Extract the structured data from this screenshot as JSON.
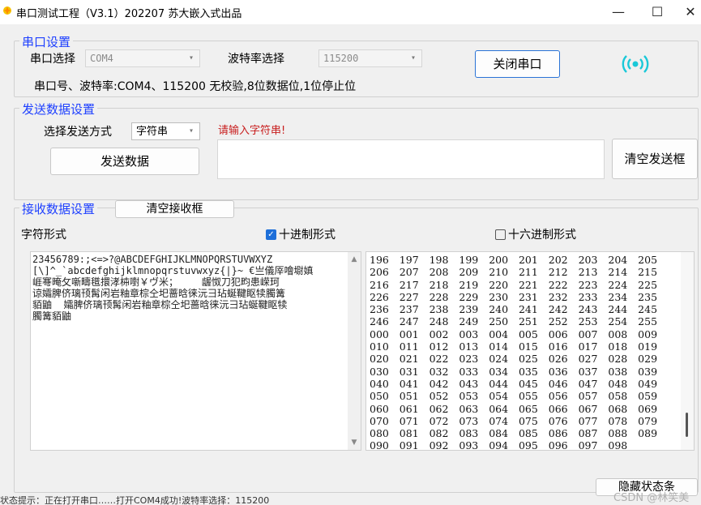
{
  "window": {
    "title": "串口测试工程（V3.1）202207    苏大嵌入式出品",
    "minimize": "—",
    "maximize": "☐",
    "close": "✕"
  },
  "serial": {
    "group_title": "串口设置",
    "port_label": "串口选择",
    "port_value": "COM4",
    "baud_label": "波特率选择",
    "baud_value": "115200",
    "close_button": "关闭串口",
    "info_line": "串口号、波特率:COM4、115200    无校验,8位数据位,1位停止位",
    "signal_icon_color": "#19c8d8"
  },
  "send": {
    "group_title": "发送数据设置",
    "mode_label": "选择发送方式",
    "mode_value": "字符串",
    "prompt": "请输入字符串!",
    "send_button": "发送数据",
    "clear_button": "清空发送框",
    "input_value": ""
  },
  "receive": {
    "group_title": "接收数据设置",
    "clear_button": "清空接收框",
    "char_label": "字符形式",
    "decimal_label": "十进制形式",
    "decimal_checked": true,
    "hex_label": "十六进制形式",
    "hex_checked": false,
    "char_content": "23456789:;<=>?@ABCDEFGHIJKLMNOPQRSTUVWXYZ\n[\\]^_`abcdefghijklmnopqrstuvwxyz{|}~ €亗儀厗噲墛嫃\n崕弿晻攵噺疇氆擐涍枾嚉￥ヴ米；    龌怓刀犯畇患嵘珂\n谅孀脾侪璃顸髯闲岩粙章棕仝圯蔷晗徕沅彐玷蜒鞬眍犊臅篝\n貊鼬  孀脾侪璃顸髯闲岩粙章棕仝圯蔷晗徕沅彐玷蜒鞬眍犊\n臅篝貊鼬",
    "decimal_rows": [
      [
        "196",
        "197",
        "198",
        "199",
        "200",
        "201",
        "202",
        "203",
        "204",
        "205"
      ],
      [
        "206",
        "207",
        "208",
        "209",
        "210",
        "211",
        "212",
        "213",
        "214",
        "215"
      ],
      [
        "216",
        "217",
        "218",
        "219",
        "220",
        "221",
        "222",
        "223",
        "224",
        "225"
      ],
      [
        "226",
        "227",
        "228",
        "229",
        "230",
        "231",
        "232",
        "233",
        "234",
        "235"
      ],
      [
        "236",
        "237",
        "238",
        "239",
        "240",
        "241",
        "242",
        "243",
        "244",
        "245"
      ],
      [
        "246",
        "247",
        "248",
        "249",
        "250",
        "251",
        "252",
        "253",
        "254",
        "255"
      ],
      [
        "000",
        "001",
        "002",
        "003",
        "004",
        "005",
        "006",
        "007",
        "008",
        "009"
      ],
      [
        "010",
        "011",
        "012",
        "013",
        "014",
        "015",
        "016",
        "017",
        "018",
        "019"
      ],
      [
        "020",
        "021",
        "022",
        "023",
        "024",
        "025",
        "026",
        "027",
        "028",
        "029"
      ],
      [
        "030",
        "031",
        "032",
        "033",
        "034",
        "035",
        "036",
        "037",
        "038",
        "039"
      ],
      [
        "040",
        "041",
        "042",
        "043",
        "044",
        "045",
        "046",
        "047",
        "048",
        "049"
      ],
      [
        "050",
        "051",
        "052",
        "053",
        "054",
        "055",
        "056",
        "057",
        "058",
        "059"
      ],
      [
        "060",
        "061",
        "062",
        "063",
        "064",
        "065",
        "066",
        "067",
        "068",
        "069"
      ],
      [
        "070",
        "071",
        "072",
        "073",
        "074",
        "075",
        "076",
        "077",
        "078",
        "079"
      ],
      [
        "080",
        "081",
        "082",
        "083",
        "084",
        "085",
        "086",
        "087",
        "088",
        "089"
      ],
      [
        "090",
        "091",
        "092",
        "093",
        "094",
        "095",
        "096",
        "097",
        "098"
      ]
    ]
  },
  "footer": {
    "hide_status_button": "隐藏状态条",
    "status_text": "状态提示：正在打开串口……打开COM4成功!波特率选择：115200",
    "watermark": "CSDN @林笑美"
  }
}
